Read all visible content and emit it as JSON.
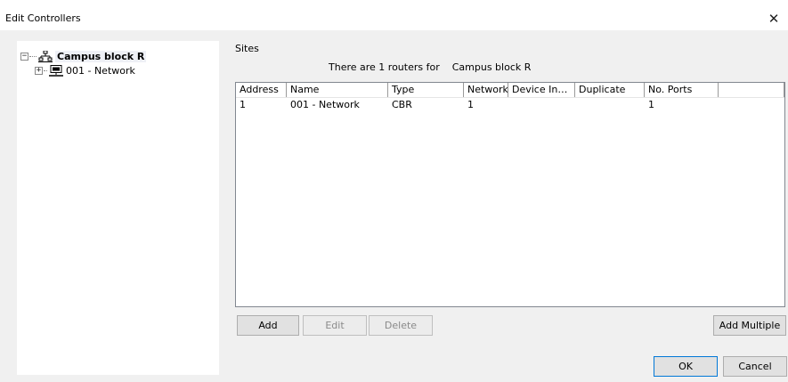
{
  "window": {
    "title": "Edit Controllers",
    "close_glyph": "✕"
  },
  "tree": {
    "root": {
      "label": "Campus block R",
      "expander": "−",
      "icon": "network-tree-icon"
    },
    "child": {
      "label": "001 - Network",
      "expander": "+",
      "icon": "monitor-icon"
    }
  },
  "sites": {
    "label": "Sites",
    "summary_prefix": "There are 1 routers for",
    "summary_site": "Campus block R"
  },
  "table": {
    "columns": [
      "Address",
      "Name",
      "Type",
      "Network",
      "Device In…",
      "Duplicate",
      "No. Ports",
      ""
    ],
    "rows": [
      [
        "1",
        "001 - Network",
        "CBR",
        "1",
        "",
        "",
        "1",
        ""
      ]
    ]
  },
  "buttons": {
    "add": "Add",
    "edit": "Edit",
    "delete": "Delete",
    "add_multiple": "Add Multiple",
    "ok": "OK",
    "cancel": "Cancel"
  }
}
